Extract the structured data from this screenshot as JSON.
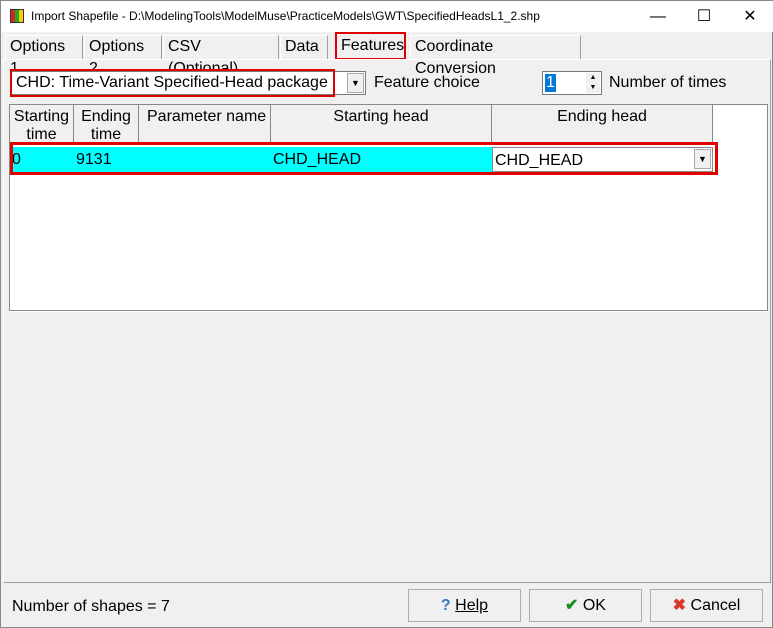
{
  "window": {
    "title": "Import Shapefile - D:\\ModelingTools\\ModelMuse\\PracticeModels\\GWT\\SpecifiedHeadsL1_2.shp",
    "minimize": "—",
    "maximize": "☐",
    "close": "✕"
  },
  "tabs": [
    {
      "label": "Options 1"
    },
    {
      "label": "Options 2"
    },
    {
      "label": "CSV (Optional)"
    },
    {
      "label": "Data"
    },
    {
      "label": "Features",
      "selected": true
    },
    {
      "label": "Coordinate Conversion"
    }
  ],
  "features": {
    "package_choice": "CHD: Time-Variant Specified-Head package",
    "feature_choice_label": "Feature choice",
    "number_of_times_value": "1",
    "number_of_times_label": "Number of times"
  },
  "grid": {
    "headers": [
      "Starting time",
      "Ending time",
      "Parameter name",
      "Starting head",
      "Ending head"
    ],
    "rows": [
      [
        "0",
        "9131",
        "",
        "CHD_HEAD",
        "CHD_HEAD"
      ]
    ]
  },
  "footer": {
    "status": "Number of shapes = 7",
    "help": "Help",
    "ok": "OK",
    "cancel": "Cancel"
  },
  "colors": {
    "highlight": "#00ffff",
    "annotation": "#e00000"
  }
}
